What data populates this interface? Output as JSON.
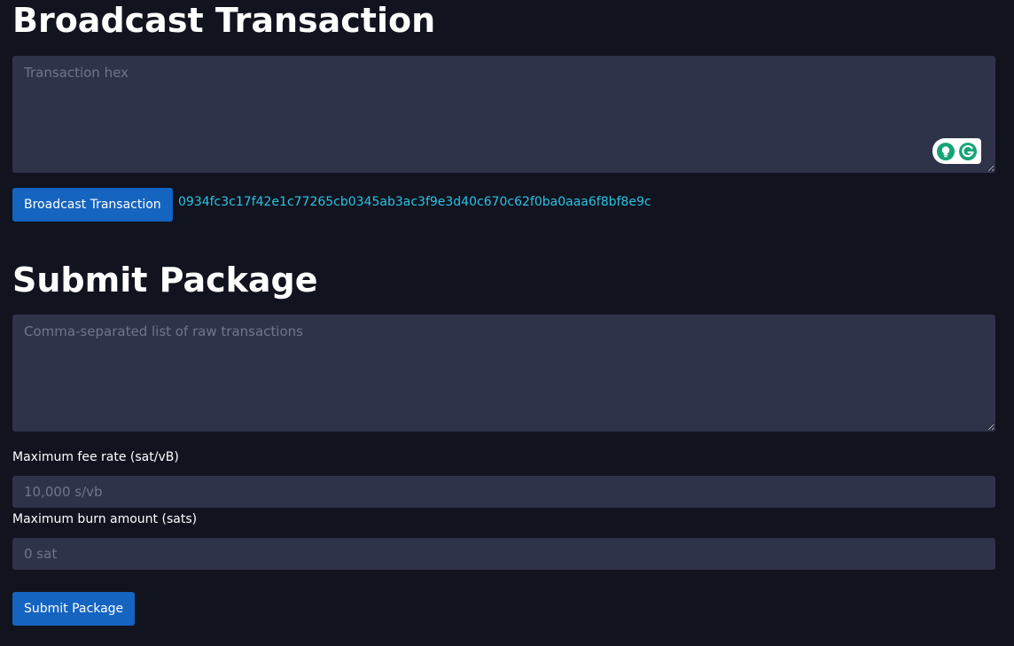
{
  "broadcast": {
    "title": "Broadcast Transaction",
    "tx_placeholder": "Transaction hex",
    "button_label": "Broadcast Transaction",
    "txid": "0934fc3c17f42e1c77265cb0345ab3ac3f9e3d40c670c62f0ba0aaa6f8bf8e9c"
  },
  "submit_package": {
    "title": "Submit Package",
    "list_placeholder": "Comma-separated list of raw transactions",
    "fee_label": "Maximum fee rate (sat/vB)",
    "fee_placeholder": "10,000 s/vb",
    "burn_label": "Maximum burn amount (sats)",
    "burn_placeholder": "0 sat",
    "button_label": "Submit Package"
  },
  "icons": {
    "grammarly_suggest": "lightbulb-icon",
    "grammarly_logo": "grammarly-g-icon"
  },
  "colors": {
    "background": "#11131f",
    "input_background": "#2f3349",
    "button": "#1564c0",
    "link": "#2ac3e3",
    "grammarly_green": "#15a376"
  }
}
